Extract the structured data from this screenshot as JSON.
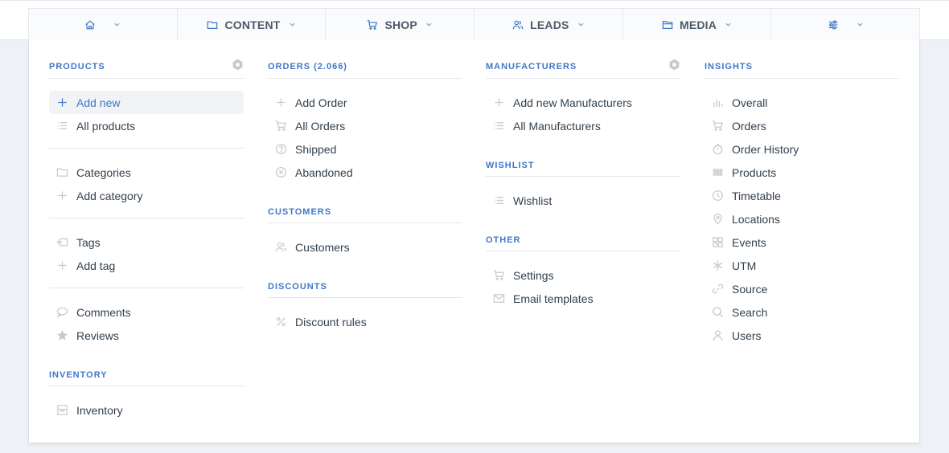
{
  "nav": {
    "items": [
      {
        "label": "",
        "icon": "home-icon"
      },
      {
        "label": "CONTENT",
        "icon": "folder-icon"
      },
      {
        "label": "SHOP",
        "icon": "cart-icon"
      },
      {
        "label": "LEADS",
        "icon": "users-icon"
      },
      {
        "label": "MEDIA",
        "icon": "media-folder-icon"
      },
      {
        "label": "",
        "icon": "sliders-icon"
      }
    ]
  },
  "colors": {
    "accent": "#3f78c9",
    "icon_gray": "#c4c9d0",
    "text": "#33404d"
  },
  "products": {
    "heading": "PRODUCTS",
    "add_new": "Add new",
    "all_products": "All products",
    "categories": "Categories",
    "add_category": "Add category",
    "tags": "Tags",
    "add_tag": "Add tag",
    "comments": "Comments",
    "reviews": "Reviews"
  },
  "inventory": {
    "heading": "INVENTORY",
    "inventory": "Inventory"
  },
  "orders": {
    "heading": "ORDERS (2.066)",
    "add_order": "Add Order",
    "all_orders": "All Orders",
    "shipped": "Shipped",
    "abandoned": "Abandoned"
  },
  "customers": {
    "heading": "CUSTOMERS",
    "customers": "Customers"
  },
  "discounts": {
    "heading": "DISCOUNTS",
    "discount_rules": "Discount rules"
  },
  "manufacturers": {
    "heading": "MANUFACTURERS",
    "add_new": "Add new Manufacturers",
    "all": "All Manufacturers"
  },
  "wishlist": {
    "heading": "WISHLIST",
    "wishlist": "Wishlist"
  },
  "other": {
    "heading": "OTHER",
    "settings": "Settings",
    "email_templates": "Email templates"
  },
  "insights": {
    "heading": "INSIGHTS",
    "items": [
      "Overall",
      "Orders",
      "Order History",
      "Products",
      "Timetable",
      "Locations",
      "Events",
      "UTM",
      "Source",
      "Search",
      "Users"
    ]
  }
}
